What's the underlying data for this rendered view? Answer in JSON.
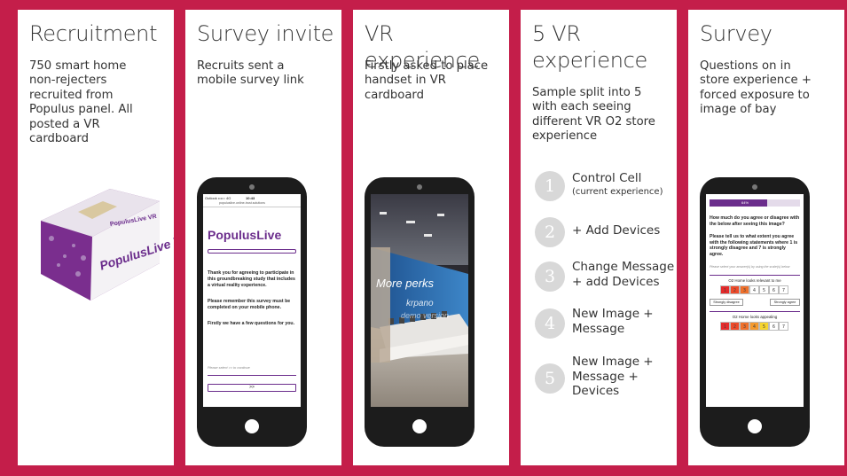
{
  "panels": [
    {
      "title": "Recruitment",
      "desc": "750 smart home\nnon-rejecters\nrecruited from\nPopulus panel. All\nposted a VR\ncardboard"
    },
    {
      "title": "Survey invite",
      "desc": "Recruits sent a\nmobile survey link"
    },
    {
      "title": "VR experience",
      "desc": "Firstly asked to place\nhandset in VR\ncardboard"
    },
    {
      "title": "5 VR\nexperience",
      "desc": "Sample split into 5\nwith each seeing\ndifferent VR O2 store\nexperience"
    },
    {
      "title": "Survey",
      "desc": "Questions on in\nstore experience +\nforced exposure to\nimage of bay"
    }
  ],
  "cardboard": {
    "brand": "PopulusLive VR",
    "brand_small": "PopulusLive VR"
  },
  "phone2": {
    "status_left": "Outlook ••••○ 4G",
    "status_time": "10:43",
    "url": "populuslive.online-trust.solutions",
    "logo": "PopulusLive",
    "p1": "Thank you for agreeing to participate in this groundbreaking study that includes a virtual reality experience.",
    "p2": "Please remember this survey must be completed on your mobile phone.",
    "p3": "Firstly we have a few questions for you.",
    "hint": "Please select >> to continue",
    "button": ">>"
  },
  "phone3": {
    "sign1": "More perks",
    "sign2": "krpano",
    "sign3": "demo version"
  },
  "steps": [
    {
      "num": "1",
      "label": "Control Cell",
      "sub": "(current experience)"
    },
    {
      "num": "2",
      "label": "+ Add Devices",
      "sub": ""
    },
    {
      "num": "3",
      "label": "Change Message\n+ add Devices",
      "sub": ""
    },
    {
      "num": "4",
      "label": "New Image +\nMessage",
      "sub": ""
    },
    {
      "num": "5",
      "label": "New Image +\nMessage +\nDevices",
      "sub": ""
    }
  ],
  "phone5": {
    "progress": "64%",
    "progress_value": 0.64,
    "question": "How much do you agree or disagree with the below after seeing this image?",
    "instruction": "Please tell us to what extent you agree with the following statements where 1 is strongly disagree and 7 is strongly agree.",
    "hint": "Please select your answer(s) by using the scale(s) below",
    "s1_label": "O2 Home looks relevant to me",
    "scale": [
      "1",
      "2",
      "3",
      "4",
      "5",
      "6",
      "7"
    ],
    "strongly_disagree": "Strongly disagree",
    "strongly_agree": "Strongly agree",
    "s2_label": "O2 Home looks appealing"
  },
  "colors": {
    "frame": "#c41e4a",
    "brand_purple": "#6b2d8c"
  }
}
